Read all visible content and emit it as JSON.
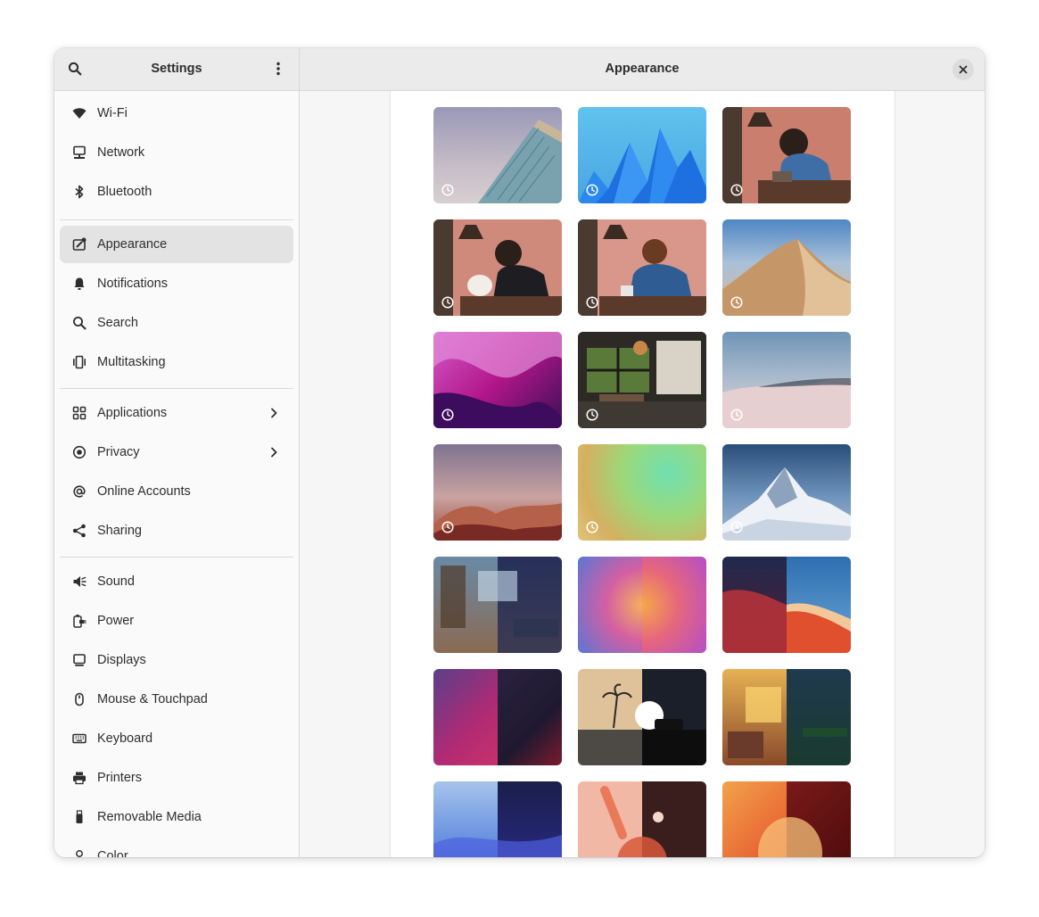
{
  "header": {
    "sidebar_title": "Settings",
    "main_title": "Appearance"
  },
  "sidebar": {
    "items": [
      {
        "label": "Wi-Fi",
        "icon": "wifi-icon"
      },
      {
        "label": "Network",
        "icon": "network-icon"
      },
      {
        "label": "Bluetooth",
        "icon": "bluetooth-icon"
      },
      {
        "label": "Appearance",
        "icon": "appearance-icon",
        "selected": true
      },
      {
        "label": "Notifications",
        "icon": "bell-icon"
      },
      {
        "label": "Search",
        "icon": "search-icon"
      },
      {
        "label": "Multitasking",
        "icon": "multitasking-icon"
      },
      {
        "label": "Applications",
        "icon": "apps-grid-icon",
        "chevron": true
      },
      {
        "label": "Privacy",
        "icon": "privacy-icon",
        "chevron": true
      },
      {
        "label": "Online Accounts",
        "icon": "at-icon"
      },
      {
        "label": "Sharing",
        "icon": "share-icon"
      },
      {
        "label": "Sound",
        "icon": "speaker-icon"
      },
      {
        "label": "Power",
        "icon": "power-plug-icon"
      },
      {
        "label": "Displays",
        "icon": "display-icon"
      },
      {
        "label": "Mouse & Touchpad",
        "icon": "mouse-icon"
      },
      {
        "label": "Keyboard",
        "icon": "keyboard-icon"
      },
      {
        "label": "Printers",
        "icon": "printer-icon"
      },
      {
        "label": "Removable Media",
        "icon": "usb-icon"
      },
      {
        "label": "Color",
        "icon": "color-icon"
      }
    ]
  },
  "wallpapers": [
    {
      "name": "building",
      "timed": true
    },
    {
      "name": "blue-peaks",
      "timed": true
    },
    {
      "name": "lofi-headphones-day",
      "timed": true
    },
    {
      "name": "lofi-headphones-cat",
      "timed": true
    },
    {
      "name": "lofi-girl-mug",
      "timed": true
    },
    {
      "name": "desert-dunes",
      "timed": true
    },
    {
      "name": "pink-mountains",
      "timed": true
    },
    {
      "name": "cafe-interior",
      "timed": true
    },
    {
      "name": "pale-dunes",
      "timed": true
    },
    {
      "name": "sunset-mountains",
      "timed": true
    },
    {
      "name": "green-gradient",
      "timed": true
    },
    {
      "name": "snowy-peak",
      "timed": true
    },
    {
      "name": "room-day-night",
      "timed": false
    },
    {
      "name": "blue-orange-gradient",
      "timed": false
    },
    {
      "name": "big-sur-waves",
      "timed": false
    },
    {
      "name": "purple-waves",
      "timed": false
    },
    {
      "name": "palm-van",
      "timed": false
    },
    {
      "name": "sunset-room",
      "timed": false
    },
    {
      "name": "blue-waves",
      "timed": false
    },
    {
      "name": "salmon-shapes",
      "timed": false
    },
    {
      "name": "orange-shapes",
      "timed": false
    }
  ]
}
